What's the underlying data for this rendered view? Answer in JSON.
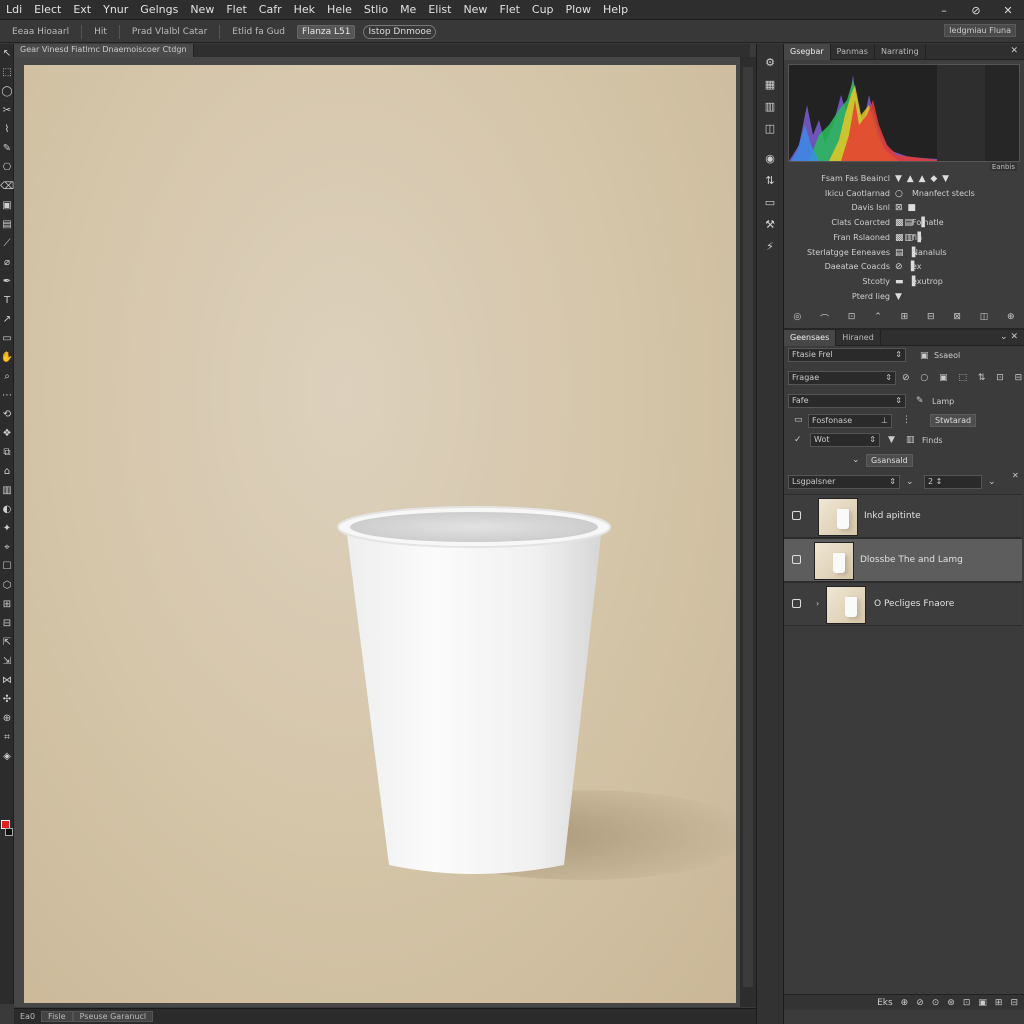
{
  "menu": [
    "Ldi",
    "Elect",
    "Ext",
    "Ynur",
    "Gelngs",
    "New",
    "Flet",
    "Cafr",
    "Hek",
    "Hele",
    "Stlio",
    "Me",
    "Elist",
    "New",
    "Flet",
    "Cup",
    "Plow",
    "Help"
  ],
  "window_controls": [
    "–",
    "⊘",
    "✕"
  ],
  "options_bar": {
    "items": [
      "Eeaa Hioaarl",
      "Hit",
      "Prad Vlalbl Catar",
      "Etlid fa Gud"
    ],
    "pill_box": "Flanza L51",
    "pill": "Istop Dnmooe",
    "right": "Iedgmiau Fluna"
  },
  "doc_tab": "Gear Vinesd Fiatlmc Dnaemoiscoer Ctdgn",
  "toolbox_icons": [
    "↖",
    "⬚",
    "◯",
    "✂",
    "⌇",
    "✎",
    "⎔",
    "⌫",
    "▣",
    "▤",
    "⟋",
    "⌀",
    "✒",
    "T",
    "↗",
    "▭",
    "✋",
    "⌕",
    "⋯",
    "⟲",
    "❖",
    "⧉",
    "⌂",
    "▥",
    "◐",
    "✦",
    "⌖",
    "☐",
    "⬡",
    "⊞",
    "⊟",
    "⇱",
    "⇲",
    "⋈",
    "✣",
    "⊕",
    "⌗",
    "⎘",
    "◈"
  ],
  "status_bar": [
    "Ea0",
    "Fisle",
    "Pseuse Garanucl"
  ],
  "icon_strip": [
    "⚙",
    "▦",
    "▥",
    "◫",
    "◉",
    "⇅",
    "▭",
    "⚒",
    "⚡"
  ],
  "histogram_panel": {
    "tabs": [
      "Gsegbar",
      "Panmas",
      "Narrating"
    ],
    "menu": "✕",
    "label": "Eanbis"
  },
  "properties": [
    {
      "label": "Fsam Fas Beaincl",
      "icons": "▼ ▲ ▲ ◆ ▼",
      "value": ""
    },
    {
      "label": "Ikicu Caotlarnad",
      "icons": "○",
      "value": "Mnanfect stecls"
    },
    {
      "label": "Davis Isnl",
      "icons": "⊠ ■",
      "value": ""
    },
    {
      "label": "Clats Coarcted",
      "icons": "▩▤ ▐",
      "value": "Folhatle"
    },
    {
      "label": "Fran Rslaoned",
      "icons": "▩▥▐",
      "value": "fin"
    },
    {
      "label": "Sterlatgge Eeneaves",
      "icons": "▤ ▐",
      "value": "Nanaluls"
    },
    {
      "label": "Daeatae Coacds",
      "icons": "⊘ ▐",
      "value": "ex"
    },
    {
      "label": "Stcotly",
      "icons": "▬ ▐",
      "value": "exutrop"
    },
    {
      "label": "Pterd lieg",
      "icons": "▼",
      "value": ""
    }
  ],
  "prop_toolbar_icons": [
    "◎",
    "⌒",
    "⊡",
    "⌃",
    "⊞",
    "⊟",
    "⊠",
    "◫",
    "⊕"
  ],
  "layers_panel": {
    "tabs": [
      "Geensaes",
      "Hiraned"
    ],
    "menu": "⌄ ✕",
    "row1": {
      "field": "Ftasie Frel",
      "btn": "Ssaeol"
    },
    "row2": {
      "field": "Fragae",
      "icons": "⊘ ○ ▣ ⬚ ⇅ ⊡ ⊟"
    },
    "row3": {
      "field": "Fafe",
      "toggle": "Lamp"
    },
    "row4": {
      "field": "Fosfonase",
      "mid": "⊥",
      "btn": "Stwtarad"
    },
    "row5": {
      "check": "✓",
      "field": "Wot",
      "icons": "▼",
      "right": "Finds"
    },
    "row6": {
      "btn": "Gsansald"
    },
    "row7": {
      "field": "Lsgpalsner",
      "stepper": "2 ↕",
      "icon": "✕"
    }
  },
  "layers": [
    {
      "name": "Inkd apitinte",
      "selected": false
    },
    {
      "name": "Dlossbe The and Lamg",
      "selected": true
    },
    {
      "name": "O Pecliges Fnaore",
      "selected": false
    }
  ],
  "panel_footer_icons": [
    "Eks",
    "⊕",
    "⊘",
    "⊙",
    "⊛",
    "⊡",
    "▣",
    "⊞",
    "⊟"
  ]
}
